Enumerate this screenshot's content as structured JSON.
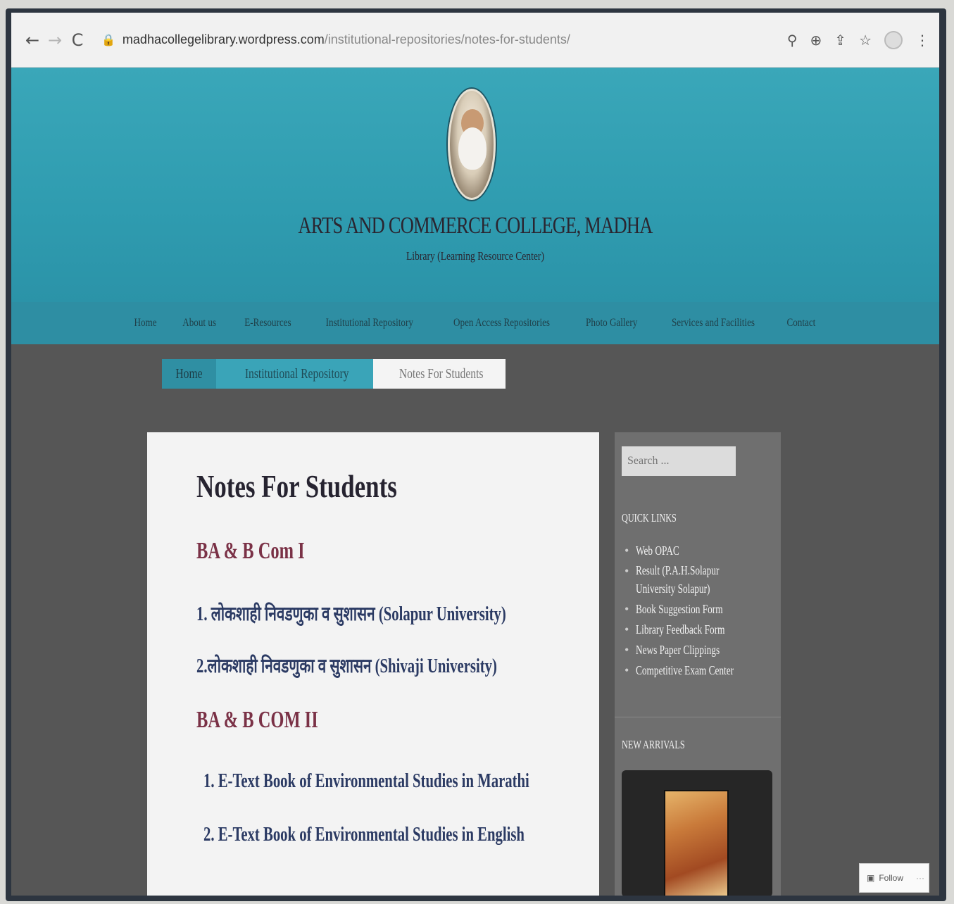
{
  "browser": {
    "back": "←",
    "forward": "→",
    "reload": "C",
    "url_host": "madhacollegelibrary.wordpress.com",
    "url_path": "/institutional-repositories/notes-for-students/",
    "icons": [
      "zoom-icon",
      "extension-icon",
      "share-icon",
      "bookmark-star-icon",
      "profile-icon",
      "menu-kebab-icon"
    ]
  },
  "header": {
    "title": "ARTS AND COMMERCE COLLEGE, MADHA",
    "subtitle": "Library (Learning Resource Center)"
  },
  "menu": [
    "Home",
    "About us",
    "E-Resources",
    "Institutional Repository",
    "Open Access Repositories",
    "Photo Gallery",
    "Services and Facilities",
    "Contact"
  ],
  "breadcrumb": {
    "home": "Home",
    "parent": "Institutional Repository",
    "current": "Notes For Students"
  },
  "content": {
    "title": "Notes For Students",
    "section1": "BA & B Com I",
    "section1_links": [
      "1. लोकशाही निवडणुका व सुशासन (Solapur University)",
      "2.लोकशाही निवडणुका व सुशासन (Shivaji University)"
    ],
    "section2": "BA & B COM II",
    "section2_links": [
      "1. E-Text Book of Environmental Studies in Marathi",
      "2. E-Text Book of Environmental Studies in English"
    ]
  },
  "sidebar": {
    "search_placeholder": "Search ...",
    "quick_links_title": "QUICK LINKS",
    "quick_links": [
      "Web OPAC",
      "Result (P.A.H.Solapur University Solapur)",
      "Book Suggestion Form",
      "Library Feedback Form",
      "News Paper Clippings",
      "Competitive Exam Center"
    ],
    "new_arrivals_title": "NEW ARRIVALS"
  },
  "follow": {
    "label": "Follow",
    "more": "···"
  }
}
